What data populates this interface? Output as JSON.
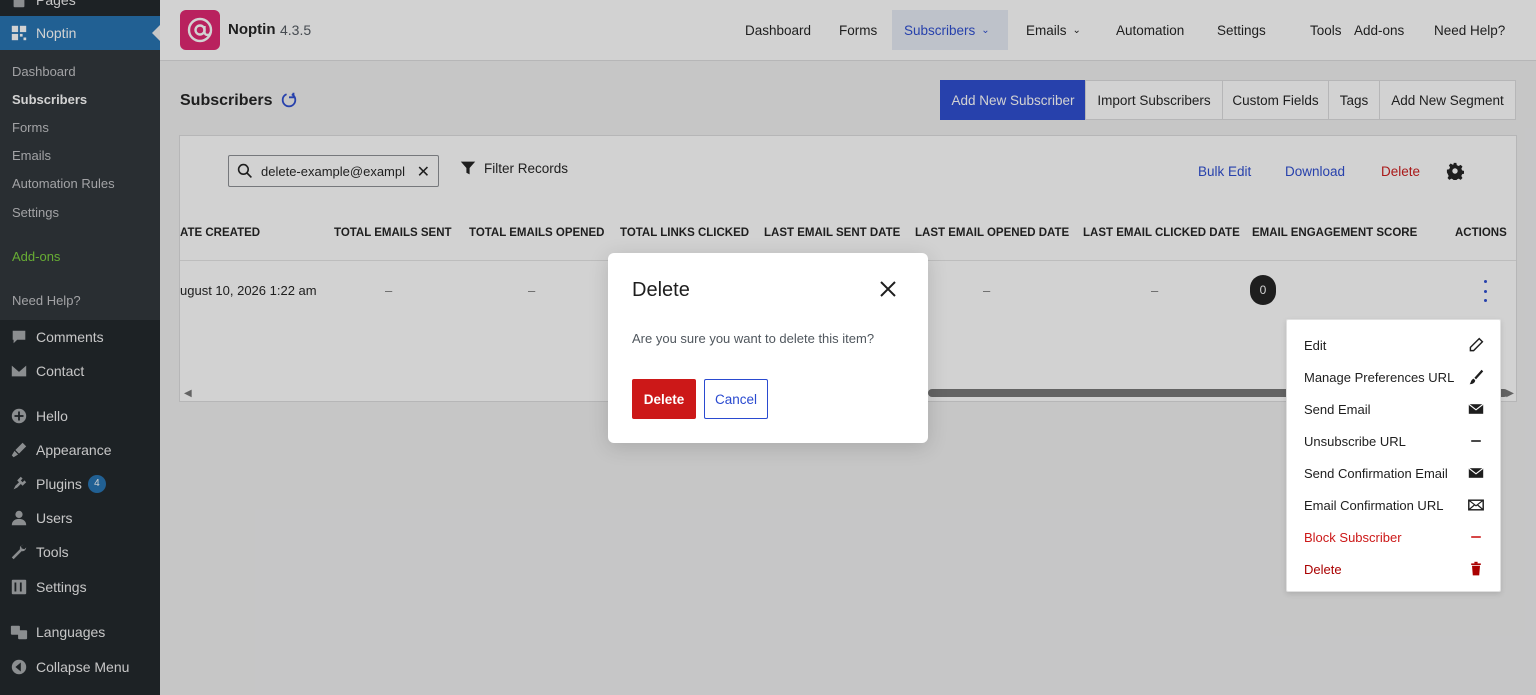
{
  "wp_menu": {
    "pages_label": "Pages",
    "noptin_label": "Noptin",
    "submenu": [
      "Dashboard",
      "Subscribers",
      "Forms",
      "Emails",
      "Automation Rules",
      "Settings"
    ],
    "addons_label": "Add-ons",
    "help_label": "Need Help?",
    "comments_label": "Comments",
    "contact_label": "Contact",
    "hello_label": "Hello",
    "appearance_label": "Appearance",
    "plugins_label": "Plugins",
    "plugins_badge": "4",
    "users_label": "Users",
    "tools_label": "Tools",
    "settings_label": "Settings",
    "languages_label": "Languages",
    "collapse_label": "Collapse Menu"
  },
  "brand": {
    "name": "Noptin",
    "version": "4.3.5"
  },
  "nav": {
    "dashboard": "Dashboard",
    "forms": "Forms",
    "subscribers": "Subscribers",
    "emails": "Emails",
    "automation": "Automation",
    "settings": "Settings",
    "tools": "Tools",
    "addons": "Add-ons",
    "help": "Need Help?"
  },
  "page": {
    "title": "Subscribers"
  },
  "actions": {
    "add_new": "Add New Subscriber",
    "import": "Import Subscribers",
    "custom_fields": "Custom Fields",
    "tags": "Tags",
    "add_segment": "Add New Segment"
  },
  "toolbar": {
    "search_value": "delete-example@exampl",
    "filter_label": "Filter Records",
    "bulk_edit": "Bulk Edit",
    "download": "Download",
    "delete": "Delete"
  },
  "table": {
    "headers": {
      "date_created": "ATE CREATED",
      "emails_sent": "TOTAL EMAILS SENT",
      "emails_opened": "TOTAL EMAILS OPENED",
      "links_clicked": "TOTAL LINKS CLICKED",
      "last_sent": "LAST EMAIL SENT DATE",
      "last_opened": "LAST EMAIL OPENED DATE",
      "last_clicked": "LAST EMAIL CLICKED DATE",
      "engagement": "EMAIL ENGAGEMENT SCORE",
      "actions": "ACTIONS"
    },
    "row": {
      "date_created": "ugust 10, 2026 1:22 am",
      "emails_sent": "–",
      "emails_opened": "–",
      "last_opened": "–",
      "last_clicked": "–",
      "engagement_score": "0"
    }
  },
  "actions_menu": {
    "edit": "Edit",
    "manage_prefs": "Manage Preferences URL",
    "send_email": "Send Email",
    "unsubscribe": "Unsubscribe URL",
    "send_confirmation": "Send Confirmation Email",
    "confirmation_url": "Email Confirmation URL",
    "block": "Block Subscriber",
    "delete": "Delete"
  },
  "modal": {
    "title": "Delete",
    "message": "Are you sure you want to delete this item?",
    "confirm_label": "Delete",
    "cancel_label": "Cancel"
  },
  "colors": {
    "primary": "#2a4ad0",
    "danger": "#cc1818",
    "brand": "#e0226e",
    "sidebar": "#1d2327"
  }
}
